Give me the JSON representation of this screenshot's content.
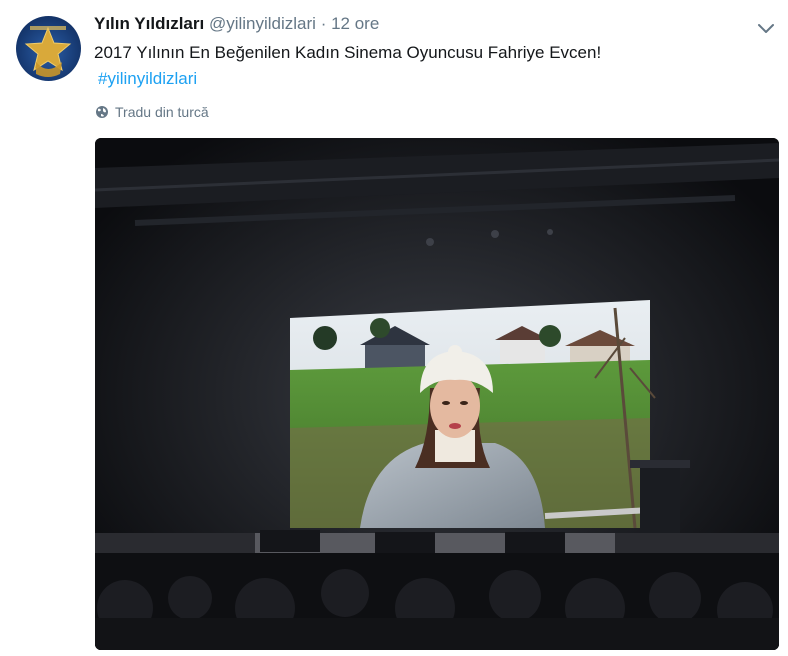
{
  "tweet": {
    "display_name": "Yılın Yıldızları",
    "handle": "@yilinyildizlari",
    "separator": "·",
    "timestamp": "12 ore",
    "text": "2017 Yılının En Beğenilen Kadın Sinema Oyuncusu Fahriye Evcen!",
    "hashtag": "#yilinyildizlari",
    "translate_label": "Tradu din turcă"
  },
  "colors": {
    "link": "#1da1f2",
    "secondary_text": "#657786",
    "primary_text": "#14171a"
  },
  "icons": {
    "avatar": "star-logo-icon",
    "menu": "chevron-down-icon",
    "translate": "globe-icon"
  }
}
